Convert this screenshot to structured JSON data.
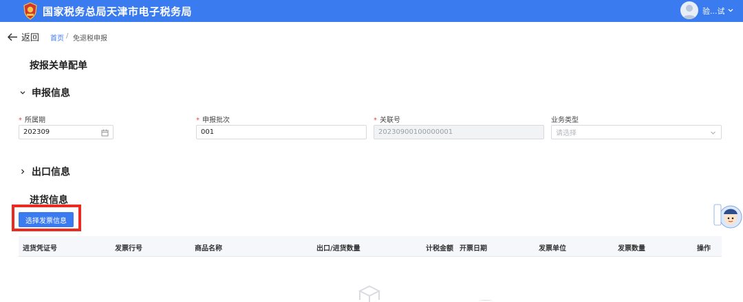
{
  "header": {
    "title": "国家税务总局天津市电子税务局",
    "user_name": "验...试",
    "brand_color": "#3a7bf0"
  },
  "nav": {
    "back_label": "返回",
    "breadcrumb": {
      "home": "首页",
      "separator": "/",
      "current": "免退税申报"
    }
  },
  "page": {
    "title": "按报关单配单"
  },
  "sections": {
    "declare": "申报信息",
    "export": "出口信息",
    "purchase": "进货信息"
  },
  "form": {
    "period": {
      "label": "所属期",
      "value": "202309",
      "required": true
    },
    "batch": {
      "label": "申报批次",
      "value": "001",
      "required": true
    },
    "link_no": {
      "label": "关联号",
      "value": "20230900100000001",
      "required": true
    },
    "biz_type": {
      "label": "业务类型",
      "placeholder": "请选择",
      "required": false
    }
  },
  "purchase": {
    "select_invoice_button": "选择发票信息",
    "columns": [
      "进货凭证号",
      "发票行号",
      "商品名称",
      "出口/进货数量",
      "计税金额",
      "开票日期",
      "发票单位",
      "发票数量",
      "操作"
    ]
  },
  "icons": {
    "logo": "tax-emblem-icon",
    "avatar": "user-avatar-icon",
    "calendar": "calendar-icon",
    "dropdown": "chevron-down-icon",
    "helper": "assistant-mascot-icon"
  },
  "colors": {
    "highlight": "#ea2b1f",
    "required": "#e34848"
  }
}
